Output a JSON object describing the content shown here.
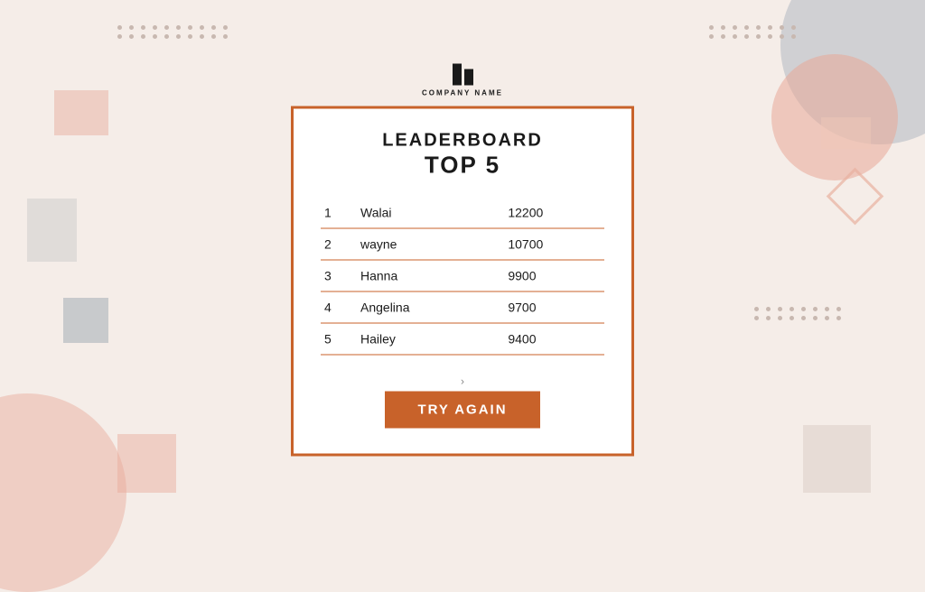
{
  "background": {
    "color": "#f5ede8"
  },
  "company": {
    "name": "COMPANY NAME"
  },
  "card": {
    "title_line1": "LEADERBOARD",
    "title_line2": "TOP 5",
    "border_color": "#c8622a"
  },
  "leaderboard": {
    "entries": [
      {
        "rank": "1",
        "name": "Walai",
        "score": "12200"
      },
      {
        "rank": "2",
        "name": "wayne",
        "score": "10700"
      },
      {
        "rank": "3",
        "name": "Hanna",
        "score": "9900"
      },
      {
        "rank": "4",
        "name": "Angelina",
        "score": "9700"
      },
      {
        "rank": "5",
        "name": "Hailey",
        "score": "9400"
      }
    ]
  },
  "button": {
    "try_again": "TRY AGAIN"
  },
  "chevron": "›"
}
